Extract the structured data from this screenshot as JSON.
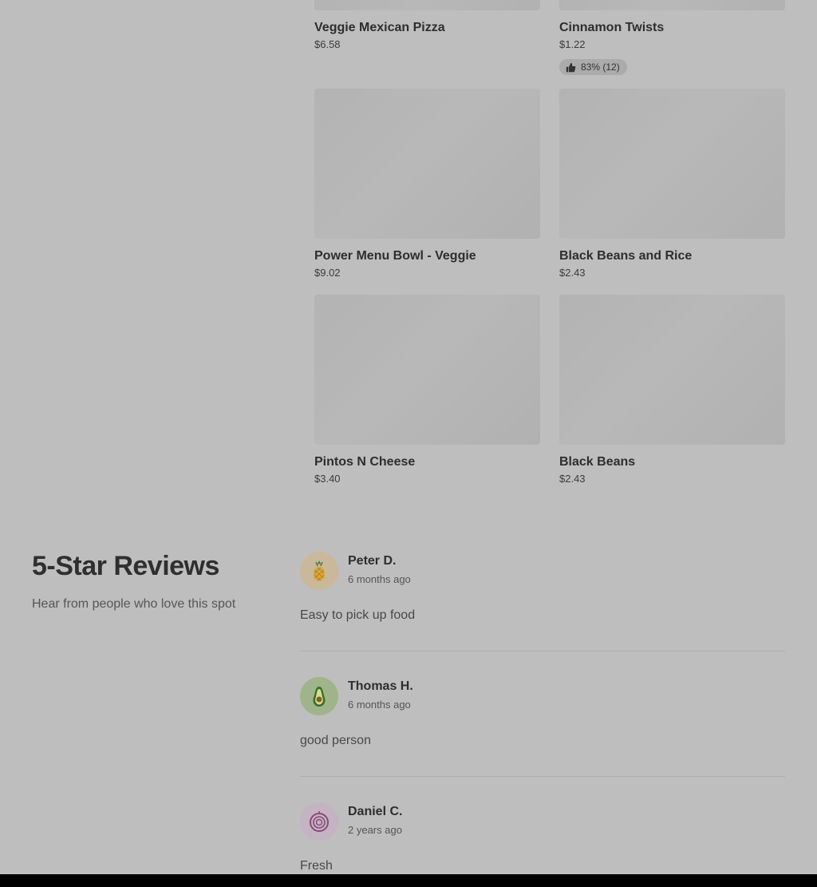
{
  "menu_items": [
    {
      "name": "Veggie Mexican Pizza",
      "price": "$6.58"
    },
    {
      "name": "Cinnamon Twists",
      "price": "$1.22",
      "rating": "83% (12)"
    },
    {
      "name": "Power Menu Bowl - Veggie",
      "price": "$9.02"
    },
    {
      "name": "Black Beans and Rice",
      "price": "$2.43"
    },
    {
      "name": "Pintos N Cheese",
      "price": "$3.40"
    },
    {
      "name": "Black Beans",
      "price": "$2.43"
    }
  ],
  "reviews_section": {
    "title": "5-Star Reviews",
    "subtitle": "Hear from people who love this spot"
  },
  "reviews": [
    {
      "author": "Peter D.",
      "time": "6 months ago",
      "text": "Easy to pick up food",
      "avatar_icon": "pineapple-icon",
      "avatar_color": "#c9b89a"
    },
    {
      "author": "Thomas H.",
      "time": "6 months ago",
      "text": "good person",
      "avatar_icon": "avocado-icon",
      "avatar_color": "#9fb48a"
    },
    {
      "author": "Daniel C.",
      "time": "2 years ago",
      "text": "Fresh",
      "avatar_icon": "onion-icon",
      "avatar_color": "#c4b3c2"
    }
  ],
  "icons": {
    "rating": "thumbs-up-icon"
  }
}
